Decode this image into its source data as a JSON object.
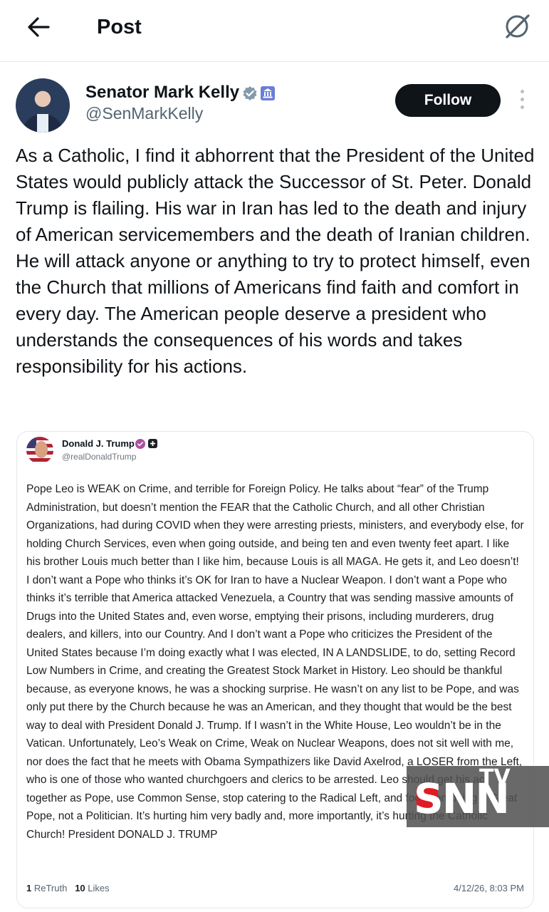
{
  "header": {
    "title": "Post",
    "back_icon": "arrow-left-icon",
    "grok_icon": "grok-slash-icon"
  },
  "post": {
    "author_name": "Senator Mark Kelly",
    "author_handle": "@SenMarkKelly",
    "follow_label": "Follow",
    "text": "As a Catholic, I find it abhorrent that the President of the United States would publicly attack the Successor of St. Peter. Donald Trump is flailing. His war in Iran has led to the death and injury of American servicemembers and the death of Iranian children. He will attack anyone or anything to try to protect himself, even the Church that millions of Americans find faith and comfort in every day. The American people deserve a president who understands the consequences of his words and takes responsibility for his actions."
  },
  "quoted_post": {
    "author_name": "Donald J. Trump",
    "author_handle": "@realDonaldTrump",
    "text": "Pope Leo is WEAK on Crime, and terrible for Foreign Policy. He talks about “fear” of the Trump Administration, but doesn’t mention the FEAR that the Catholic Church, and all other Christian Organizations, had during COVID when they were arresting priests, ministers, and everybody else, for holding Church Services, even when going outside, and being ten and even twenty feet apart. I like his brother Louis much better than I like him, because Louis is all MAGA. He gets it, and Leo doesn’t! I don’t want a Pope who thinks it’s OK for Iran to have a Nuclear Weapon. I don’t want a Pope who thinks it’s terrible that America attacked Venezuela, a Country that was sending massive amounts of Drugs into the United States and, even worse, emptying their prisons, including murderers, drug dealers, and killers, into our Country. And I don’t want a Pope who criticizes the President of the United States because I’m doing exactly what I was elected, IN A LANDSLIDE, to do, setting Record Low Numbers in Crime, and creating the Greatest Stock Market in History. Leo should be thankful because, as everyone knows, he was a shocking surprise. He wasn’t on any list to be Pope, and was only put there by the Church because he was an American, and they thought that would be the best way to deal with President Donald J. Trump. If I wasn’t in the White House, Leo wouldn’t be in the Vatican. Unfortunately, Leo’s Weak on Crime, Weak on Nuclear Weapons, does not sit well with me, nor does the fact that he meets with Obama Sympathizers like David Axelrod, a LOSER from the Left, who is one of those who wanted churchgoers and clerics to be arrested. Leo should get his act together as Pope, use Common Sense, stop catering to the Radical Left, and focus on being a Great Pope, not a Politician. It’s hurting him very badly and, more importantly, it’s hurting the Catholic Church! President DONALD J. TRUMP",
    "retruth_count": "1",
    "retruth_label": "ReTruth",
    "likes_count": "10",
    "likes_label": "Likes",
    "timestamp": "4/12/26, 8:03 PM"
  },
  "watermark": {
    "brand": "SNN",
    "suffix": "TV"
  },
  "colors": {
    "text": "#0f1419",
    "secondary": "#536471",
    "verified": "#829aab",
    "follow_bg": "#0f1419",
    "watermark_red": "#e11b22"
  }
}
